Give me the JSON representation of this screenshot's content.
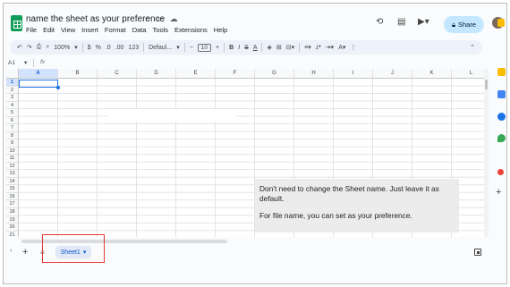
{
  "header": {
    "title": "name the sheet as your preference",
    "menu": [
      "File",
      "Edit",
      "View",
      "Insert",
      "Format",
      "Data",
      "Tools",
      "Extensions",
      "Help"
    ],
    "title_icons": [
      "star-icon",
      "move-to-folder-icon",
      "cloud-status-icon"
    ],
    "share_label": "Share"
  },
  "toolbar": {
    "undo": "↶",
    "redo": "↷",
    "print": "⎙",
    "paint_format": "⌕",
    "zoom": "100%",
    "currency": "$",
    "percent": "%",
    "decrease_decimal": ".0",
    "increase_decimal": ".00",
    "more_formats": "123",
    "font": "Defaul...",
    "font_size": "10",
    "minus": "−",
    "plus": "+",
    "bold": "B",
    "italic": "I",
    "strike": "S",
    "text_color": "A",
    "more": "⋮",
    "collapse": "⌃"
  },
  "formula_bar": {
    "name_box": "A1",
    "fx": "fx"
  },
  "grid": {
    "columns": [
      "A",
      "B",
      "C",
      "D",
      "E",
      "F",
      "G",
      "H",
      "I",
      "J",
      "K",
      "L"
    ],
    "rows": [
      "1",
      "2",
      "3",
      "4",
      "5",
      "6",
      "7",
      "8",
      "9",
      "10",
      "11",
      "12",
      "13",
      "14",
      "15",
      "16",
      "17",
      "18",
      "19",
      "20",
      "21"
    ],
    "selected_cell": "A1"
  },
  "note": {
    "line1": "Don't need to change the Sheet name. Just leave it as default.",
    "line2": "For file name, you can set as your preference."
  },
  "sheets": {
    "add": "+",
    "all": "≡",
    "tabs": [
      {
        "label": "Sheet1",
        "active": true
      }
    ]
  },
  "colors": {
    "accent": "#1a73e8",
    "share_bg": "#c2e7ff",
    "sheets_green": "#0f9d58",
    "highlight_border": "#e53935"
  }
}
